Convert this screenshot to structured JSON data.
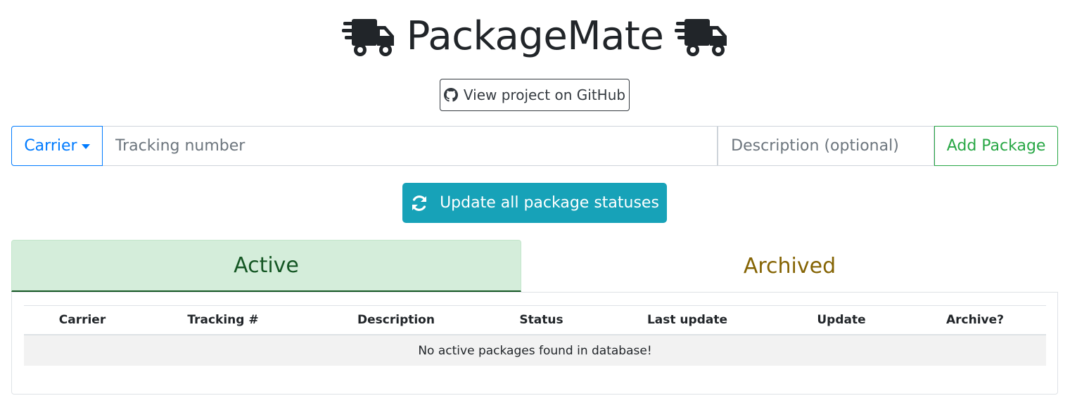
{
  "header": {
    "title": "PackageMate",
    "left_icon": "truck-icon",
    "right_icon": "truck-icon"
  },
  "github_button": {
    "label": "View project on GitHub",
    "icon": "github-icon"
  },
  "add_form": {
    "carrier_label": "Carrier",
    "tracking_placeholder": "Tracking number",
    "description_placeholder": "Description (optional)",
    "add_label": "Add Package"
  },
  "update_button": {
    "label": "Update all package statuses",
    "icon": "sync-icon"
  },
  "tabs": [
    {
      "label": "Active",
      "selected": true
    },
    {
      "label": "Archived",
      "selected": false
    }
  ],
  "table": {
    "columns": [
      "Carrier",
      "Tracking #",
      "Description",
      "Status",
      "Last update",
      "Update",
      "Archive?"
    ],
    "empty_message": "No active packages found in database!"
  },
  "colors": {
    "primary": "#007bff",
    "success": "#28a745",
    "info": "#17a2b8",
    "active_tab_bg": "#d4edda",
    "active_tab_text": "#155724",
    "archived_tab_text": "#856404"
  }
}
